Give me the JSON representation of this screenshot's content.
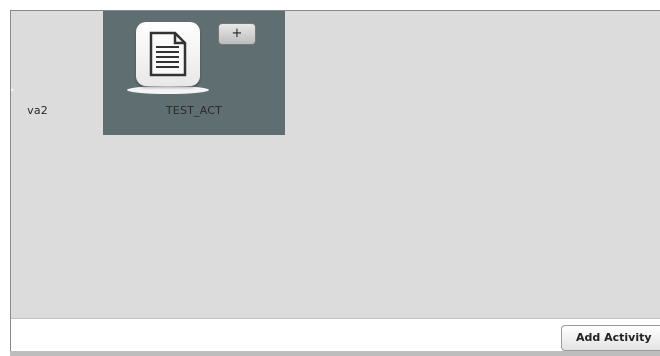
{
  "activities": [
    {
      "label": "va2",
      "icon": "document-icon",
      "selected": false
    },
    {
      "label": "TEST_ACT",
      "icon": "document-icon",
      "selected": true
    }
  ],
  "tile_add_label": "+",
  "footer": {
    "add_activity_label": "Add Activity"
  },
  "colors": {
    "canvas": "#dcdcdc",
    "selected_tile": "#5f6e70"
  }
}
